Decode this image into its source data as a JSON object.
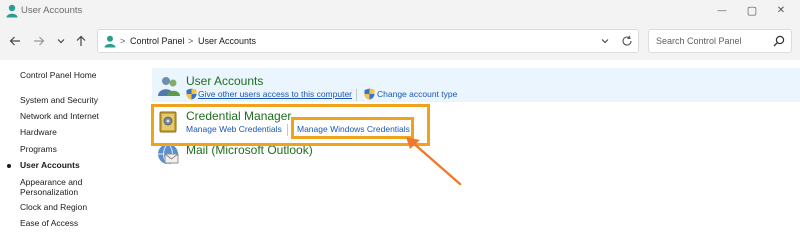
{
  "window": {
    "title": "User Accounts",
    "controls": {
      "minimize": "—",
      "maximize": "▢",
      "close": "✕"
    }
  },
  "address_bar": {
    "breadcrumbs": [
      "Control Panel",
      "User Accounts"
    ],
    "separator": ">",
    "search_placeholder": "Search Control Panel"
  },
  "sidebar": {
    "items": [
      {
        "label": "Control Panel Home"
      },
      {
        "label": "System and Security"
      },
      {
        "label": "Network and Internet"
      },
      {
        "label": "Hardware"
      },
      {
        "label": "Programs"
      },
      {
        "label": "User Accounts",
        "active": true
      },
      {
        "label": "Appearance and Personalization"
      },
      {
        "label": "Clock and Region"
      },
      {
        "label": "Ease of Access"
      }
    ]
  },
  "content": {
    "user_accounts": {
      "title": "User Accounts",
      "links": [
        "Give other users access to this computer",
        "Change account type"
      ]
    },
    "credential_manager": {
      "title": "Credential Manager",
      "links": [
        "Manage Web Credentials",
        "Manage Windows Credentials"
      ]
    },
    "mail": {
      "title": "Mail (Microsoft Outlook)"
    }
  },
  "colors": {
    "highlight_box": "#f0a21c",
    "arrow": "#ef7a2e",
    "link": "#1a57b5",
    "category_title": "#1e6e1e",
    "row_highlight": "#eaf5fd"
  }
}
